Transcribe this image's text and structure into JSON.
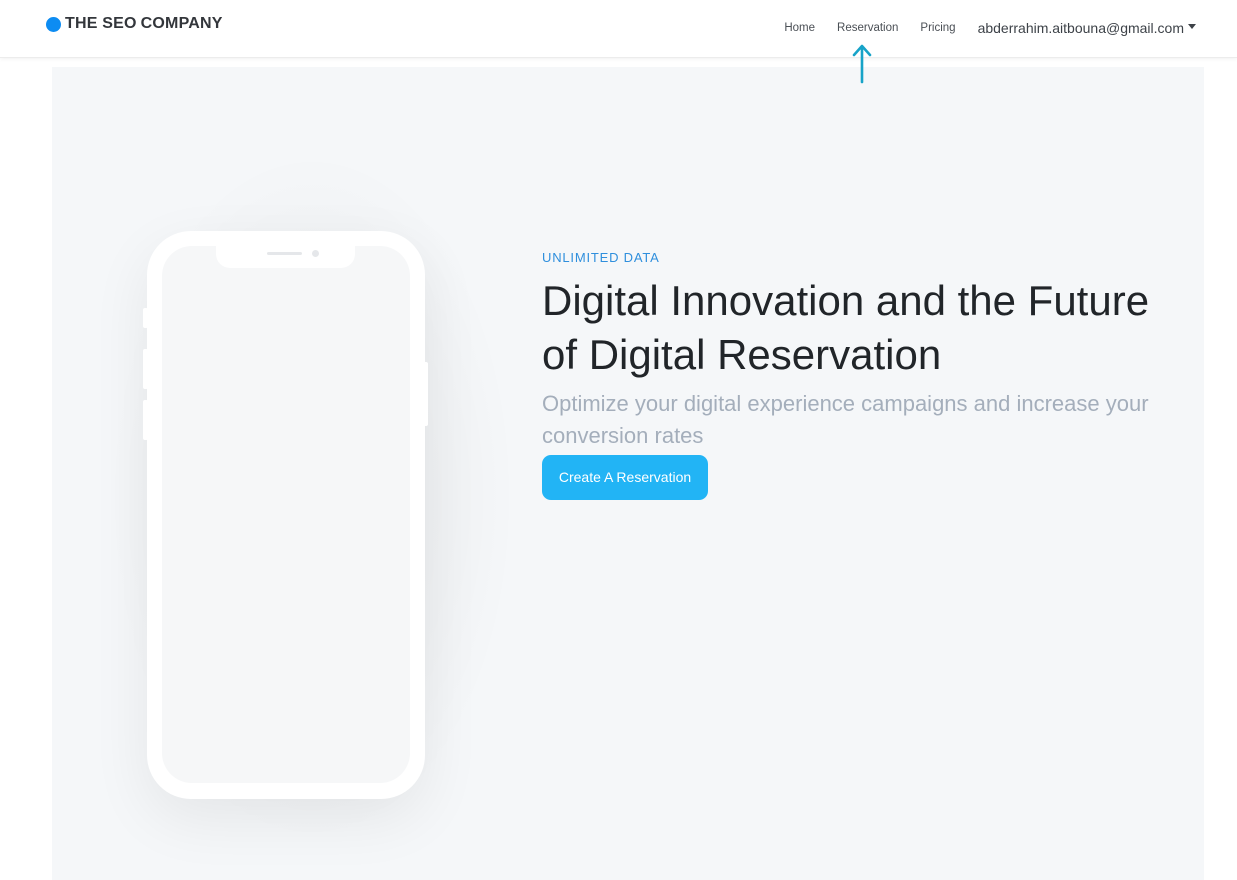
{
  "navbar": {
    "brand": {
      "part1": "THE SEO",
      "part2": "COMPANY"
    },
    "links": [
      {
        "label": "Home"
      },
      {
        "label": "Reservation"
      },
      {
        "label": "Pricing"
      }
    ],
    "user_email": "abderrahim.aitbouna@gmail.com",
    "brand_color": "#0d8cf2"
  },
  "hero": {
    "eyebrow": "UNLIMITED DATA",
    "headline_light": "Digital Innovation and the ",
    "headline_strong": "Future of Digital Reservation",
    "subtitle": "Optimize your digital experience campaigns and increase your conversion rates",
    "cta_label": "Create A Reservation",
    "accent_color": "#22b4f5"
  },
  "annotation": {
    "icon": "arrow-up-icon",
    "color": "#17a3c8"
  }
}
